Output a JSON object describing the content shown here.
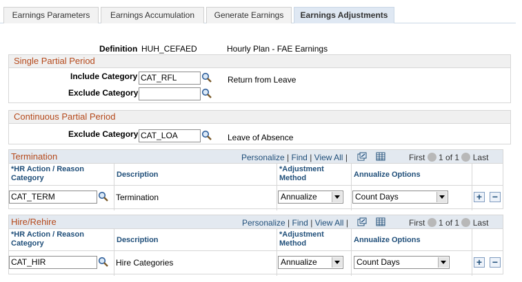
{
  "tabs": [
    {
      "label": "Earnings Parameters",
      "active": false
    },
    {
      "label": "Earnings Accumulation",
      "active": false
    },
    {
      "label": "Generate Earnings",
      "active": false
    },
    {
      "label": "Earnings Adjustments",
      "active": true
    }
  ],
  "definition": {
    "label": "Definition",
    "code": "HUH_CEFAED",
    "description": "Hourly Plan - FAE Earnings"
  },
  "single_partial_period": {
    "title": "Single Partial Period",
    "include_label": "Include Category",
    "include_value": "CAT_RFL",
    "include_description": "Return from Leave",
    "exclude_label": "Exclude Category",
    "exclude_value": ""
  },
  "continuous_partial_period": {
    "title": "Continuous Partial Period",
    "exclude_label": "Exclude Category",
    "exclude_value": "CAT_LOA",
    "exclude_description": "Leave of Absence"
  },
  "grid_nav": {
    "personalize": "Personalize",
    "find": "Find",
    "view_all": "View All",
    "first": "First",
    "range": "1 of 1",
    "last": "Last",
    "sep": "|"
  },
  "columns": {
    "hr_action": "*HR Action / Reason Category",
    "description": "Description",
    "adjustment": "*Adjustment Method",
    "annualize": "Annualize Options"
  },
  "termination": {
    "title": "Termination",
    "row": {
      "category": "CAT_TERM",
      "description": "Termination",
      "adjustment": "Annualize",
      "annualize": "Count Days"
    }
  },
  "hire_rehire": {
    "title": "Hire/Rehire",
    "row": {
      "category": "CAT_HIR",
      "description": "Hire Categories",
      "adjustment": "Annualize",
      "annualize": "Count Days"
    }
  },
  "buttons": {
    "add": "+",
    "delete": "−"
  }
}
